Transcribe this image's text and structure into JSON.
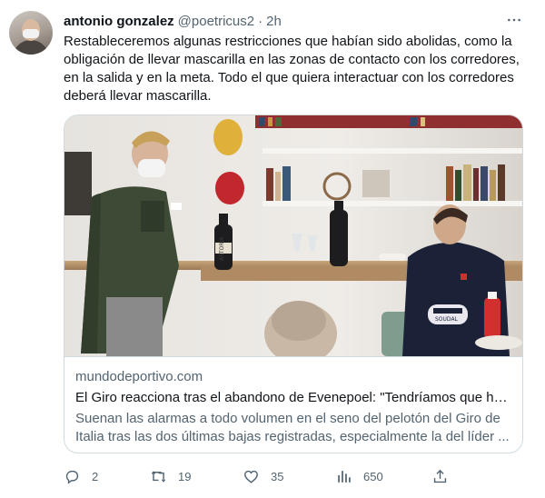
{
  "author": {
    "name": "antonio gonzalez",
    "handle": "@poetricus2",
    "separator": "·",
    "time": "2h"
  },
  "tweet": {
    "text": "Restableceremos algunas restricciones que habían sido abolidas, como la obligación de llevar mascarilla en las zonas de contacto con los corredores, en la salida y en la meta. Todo el que quiera interactuar con los corredores deberá llevar mascarilla."
  },
  "card": {
    "image_labels": {
      "bottle": "ASTORIA",
      "jersey": "SOUDAL"
    },
    "domain": "mundodeportivo.com",
    "title": "El Giro reacciona tras el abandono de Evenepoel: \"Tendríamos que hab...",
    "description": "Suenan las alarmas a todo volumen en el seno del pelotón del Giro de Italia tras las dos últimas bajas registradas, especialmente la del líder ..."
  },
  "actions": {
    "reply_count": "2",
    "retweet_count": "19",
    "like_count": "35",
    "views_count": "650"
  },
  "icons": {
    "more": "more-horizontal-icon",
    "reply": "reply-icon",
    "retweet": "retweet-icon",
    "like": "like-icon",
    "views": "views-icon",
    "share": "share-icon"
  },
  "colors": {
    "text": "#0f1419",
    "secondary": "#536471",
    "border": "#cfd9de"
  }
}
